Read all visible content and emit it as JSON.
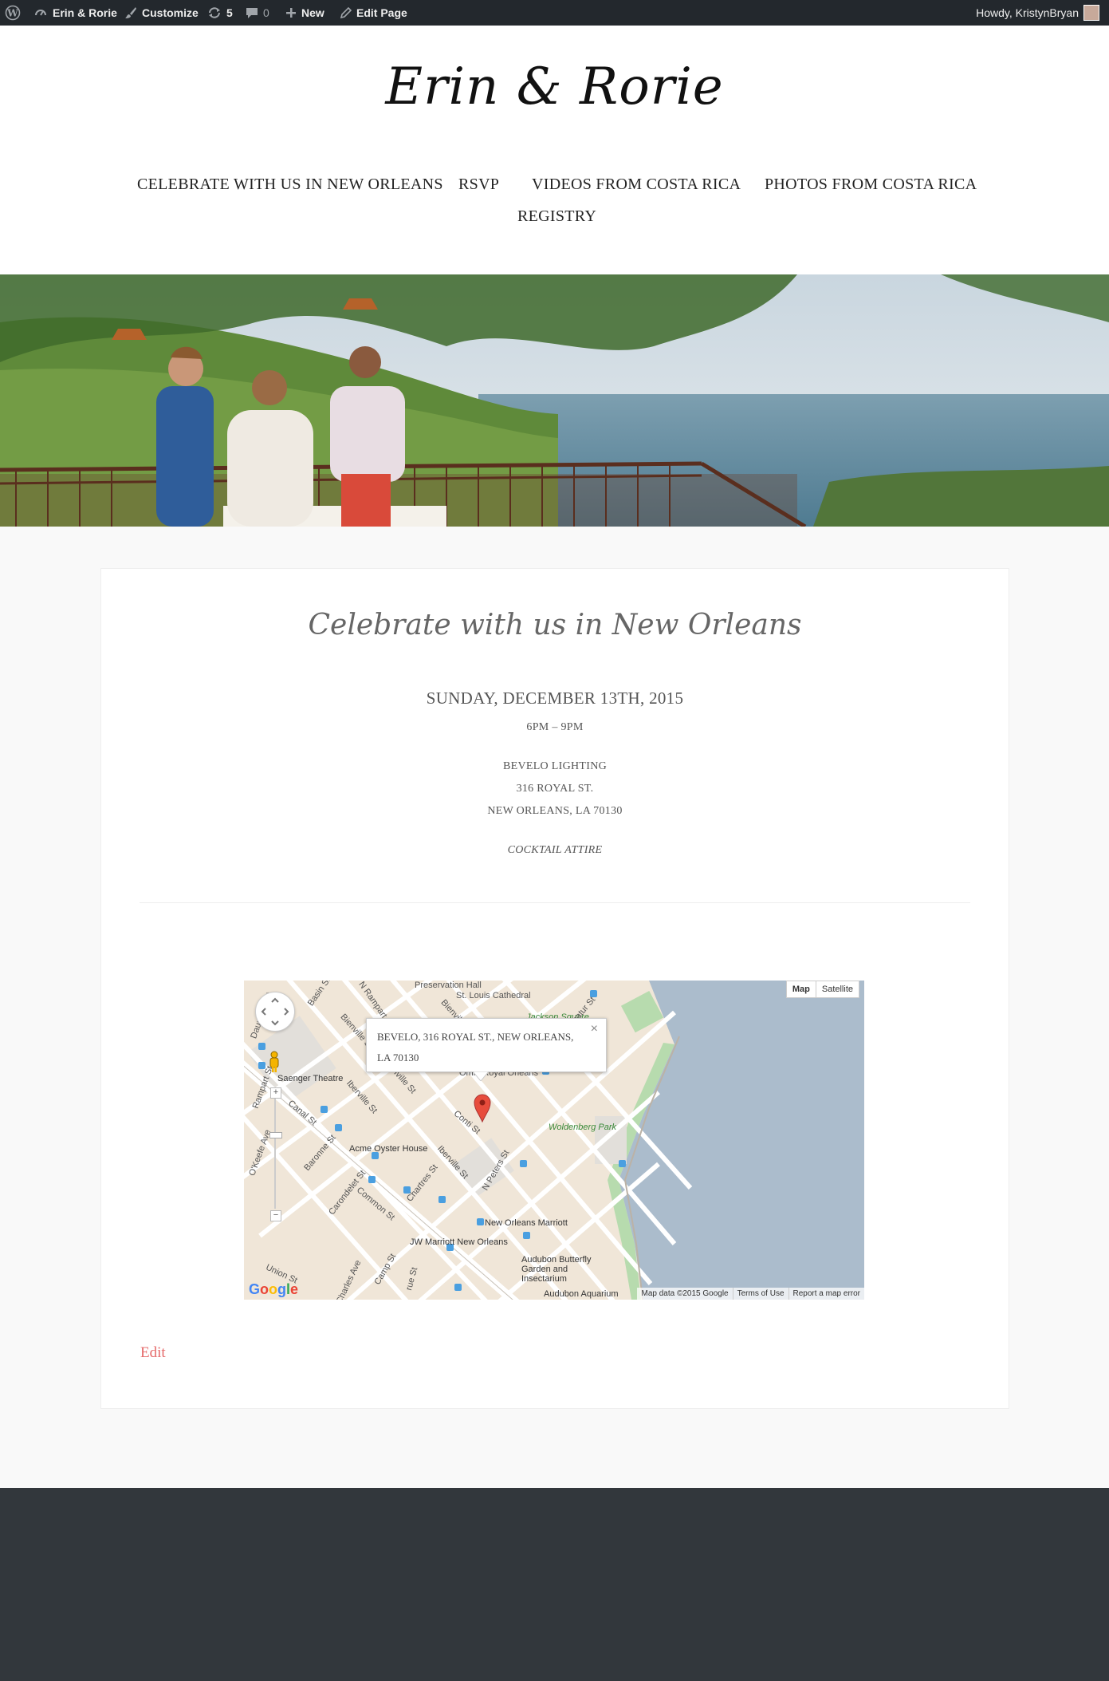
{
  "adminbar": {
    "site_name": "Erin & Rorie",
    "customize": "Customize",
    "updates_count": "5",
    "comments_count": "0",
    "new_label": "New",
    "edit_page": "Edit Page",
    "howdy": "Howdy, KristynBryan"
  },
  "site": {
    "logo": "Erin & Rorie"
  },
  "nav": {
    "items": [
      {
        "label": "CELEBRATE WITH US IN NEW ORLEANS"
      },
      {
        "label": "RSVP"
      },
      {
        "label": "VIDEOS FROM COSTA RICA"
      },
      {
        "label": "PHOTOS FROM COSTA RICA"
      },
      {
        "label": "REGISTRY"
      }
    ]
  },
  "event": {
    "title": "Celebrate with us in New Orleans",
    "date": "SUNDAY, DECEMBER 13TH, 2015",
    "time": "6PM – 9PM",
    "venue": "BEVELO LIGHTING",
    "street": "316 ROYAL ST.",
    "city": "NEW ORLEANS, LA 70130",
    "attire": "COCKTAIL ATTIRE"
  },
  "map": {
    "type_map": "Map",
    "type_satellite": "Satellite",
    "info_text": "BEVELO, 316 ROYAL ST., NEW ORLEANS, LA 70130",
    "close": "×",
    "map_data": "Map data ©2015 Google",
    "terms": "Terms of Use",
    "report": "Report a map error",
    "labels": {
      "preservation_hall": "Preservation Hall",
      "st_louis": "St. Louis Cathedral",
      "jackson_square": "Jackson Square",
      "saenger": "Saenger Theatre",
      "woldenberg": "Woldenberg Park",
      "acme": "Acme Oyster House",
      "royal_orleans": "Omni Royal Orleans",
      "marriott": "New Orleans Marriott",
      "jw_marriott": "JW Marriott New Orleans",
      "audubon": "Audubon Butterfly Garden and Insectarium",
      "aquarium": "Audubon Aquarium",
      "basin": "Basin St",
      "n_rampart": "N Rampart St",
      "bienville1": "Bienville St",
      "bienville2": "Bienville St",
      "iberville1": "Iberville St",
      "iberville2": "Iberville St",
      "decatur": "Decatur St",
      "canal": "Canal St",
      "baronne": "Baronne St",
      "carondelet": "Carondelet St",
      "common": "Common St",
      "chartres": "Chartres St",
      "conti": "Conti St",
      "n_peters": "N Peters St",
      "camp": "Camp St",
      "charles": "Charles Ave",
      "union": "Union St",
      "okeefe": "O'Keefe Ave",
      "rampart": "Rampart St",
      "dauphine": "Dauphine St",
      "rue": "rue St",
      "bienville3": "Bienville St"
    }
  },
  "edit_label": "Edit",
  "colors": {
    "adminbar_bg": "#23282d",
    "footer_bg": "#32373c",
    "edit_link": "#e56a6a",
    "water": "#abbccc",
    "park": "#b7dbae"
  }
}
